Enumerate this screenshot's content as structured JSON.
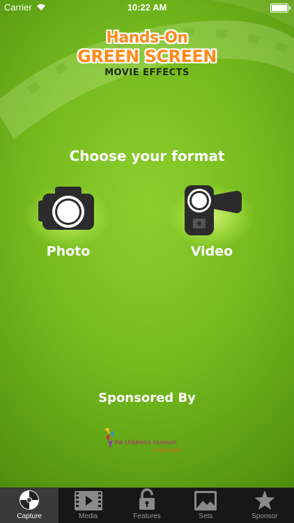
{
  "status_bar": {
    "carrier": "Carrier",
    "time": "10:22 AM",
    "battery_level": 1.0
  },
  "logo": {
    "line1": "Hands-On",
    "line2": "GREEN SCREEN",
    "line3": "MOVIE EFFECTS"
  },
  "main": {
    "heading": "Choose your format",
    "formats": [
      {
        "label": "Photo",
        "icon": "camera-icon"
      },
      {
        "label": "Video",
        "icon": "video-camera-icon"
      }
    ]
  },
  "sponsor": {
    "title": "Sponsored By",
    "logo_name": "the children's museum",
    "logo_location": "in oak lawn"
  },
  "tabbar": {
    "selected": "Capture",
    "tabs": [
      {
        "label": "Capture",
        "icon": "film-reel-icon"
      },
      {
        "label": "Media",
        "icon": "play-film-icon"
      },
      {
        "label": "Features",
        "icon": "unlock-icon"
      },
      {
        "label": "Sets",
        "icon": "image-icon"
      },
      {
        "label": "Sponsor",
        "icon": "star-icon"
      }
    ]
  },
  "colors": {
    "background": "#74ba1e",
    "logo_orange": "#ff8a1c",
    "tabbar": "#171717"
  }
}
